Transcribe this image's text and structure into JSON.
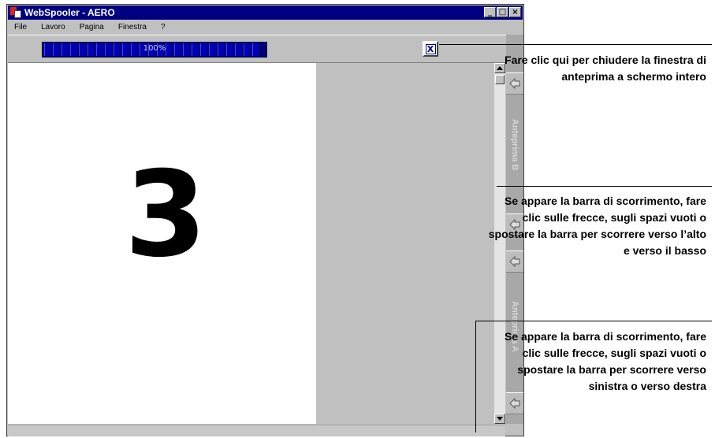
{
  "window": {
    "title": "WebSpooler - AERO",
    "minimize": "_",
    "maximize": "□",
    "close": "×"
  },
  "menu": [
    "File",
    "Lavoro",
    "Pagina",
    "Finestra",
    "?"
  ],
  "toolbar": {
    "progress_text": "100%",
    "progress_value": 1.0,
    "close_preview": "X"
  },
  "preview": {
    "page_number": "3"
  },
  "side_tabs": {
    "top": "Anteprima B",
    "bottom": "Anteprima A"
  },
  "callouts": [
    "Fare clic qui per chiudere la finestra di anteprima a schermo intero",
    "Se appare la barra di scorrimento, fare clic sulle frecce, sugli spazi vuoti o spostare la barra per scorrere verso l’alto e verso il basso",
    "Se appare la barra di scorrimento, fare clic sulle frecce, sugli spazi vuoti o spostare la barra per scorrere verso sinistra o verso destra"
  ]
}
